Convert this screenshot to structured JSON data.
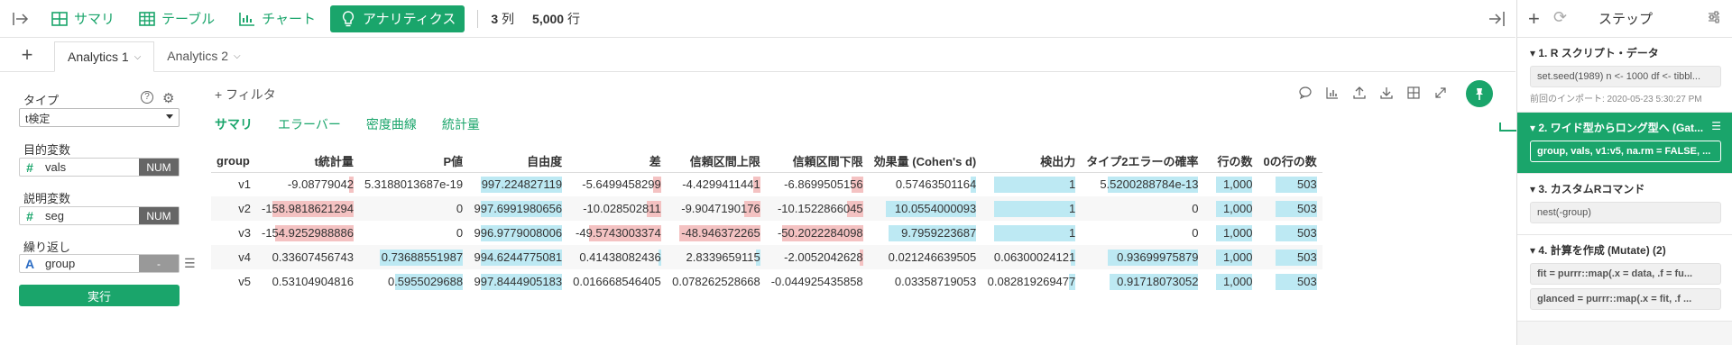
{
  "header": {
    "tabs": [
      {
        "label": "サマリ",
        "icon": "summary-icon"
      },
      {
        "label": "テーブル",
        "icon": "table-icon"
      },
      {
        "label": "チャート",
        "icon": "chart-icon"
      },
      {
        "label": "アナリティクス",
        "icon": "lightbulb-icon"
      }
    ],
    "columns_count": "3",
    "columns_unit": "列",
    "rows_count": "5,000",
    "rows_unit": "行"
  },
  "analytics_tabs": [
    "Analytics 1",
    "Analytics 2"
  ],
  "settings": {
    "type_label": "タイプ",
    "type_value": "t検定",
    "target_label": "目的変数",
    "target_value": "vals",
    "target_badge": "NUM",
    "explanatory_label": "説明変数",
    "explanatory_value": "seg",
    "explanatory_badge": "NUM",
    "repeat_label": "繰り返し",
    "repeat_value": "group",
    "repeat_badge": "-",
    "run_label": "実行"
  },
  "main": {
    "filter_label": "フィルタ",
    "subtabs": [
      "サマリ",
      "エラーバー",
      "密度曲線",
      "統計量"
    ]
  },
  "table": {
    "columns": [
      "group",
      "t統計量",
      "P値",
      "自由度",
      "差",
      "信頼区間上限",
      "信頼区間下限",
      "効果量 (Cohen's d)",
      "検出力",
      "タイプ2エラーの確率",
      "行の数",
      "0の行の数"
    ],
    "rows": [
      [
        "v1",
        "-9.08779042",
        "5.3188013687e-19",
        "997.224827119",
        "-5.6499458299",
        "-4.4299411441",
        "-6.8699505156",
        "0.57463501164",
        "1",
        "5.5200288784e-13",
        "1,000",
        "503"
      ],
      [
        "v2",
        "-158.9818621294",
        "0",
        "997.6991980656",
        "-10.028502811",
        "-9.9047190176",
        "-10.1522866045",
        "10.0554000093",
        "1",
        "0",
        "1,000",
        "503"
      ],
      [
        "v3",
        "-154.9252988886",
        "0",
        "996.9779008006",
        "-49.5743003374",
        "-48.946372265",
        "-50.2022284098",
        "9.7959223687",
        "1",
        "0",
        "1,000",
        "503"
      ],
      [
        "v4",
        "0.33607456743",
        "0.73688551987",
        "994.6244775081",
        "0.41438082436",
        "2.8339659115",
        "-2.0052042628",
        "0.021246639505",
        "0.06300024121",
        "0.93699975879",
        "1,000",
        "503"
      ],
      [
        "v5",
        "0.53104904816",
        "0.5955029688",
        "997.8444905183",
        "0.016668546405",
        "0.078262528668",
        "-0.044925435858",
        "0.03358719053",
        "0.082819269477",
        "0.91718073052",
        "1,000",
        "503"
      ]
    ],
    "bars": [
      [
        null,
        -0.06,
        0.0,
        1.0,
        -0.11,
        -0.09,
        -0.14,
        0.06,
        1.0,
        1.0,
        1.0,
        1.0
      ],
      [
        null,
        -1.0,
        0.0,
        1.0,
        -0.2,
        -0.2,
        -0.2,
        1.0,
        1.0,
        0.0,
        1.0,
        1.0
      ],
      [
        null,
        -0.97,
        0.0,
        1.0,
        -1.0,
        -1.0,
        -1.0,
        0.97,
        1.0,
        0.0,
        1.0,
        1.0
      ],
      [
        null,
        0.0,
        1.0,
        1.0,
        0.01,
        0.06,
        -0.04,
        0.0,
        0.06,
        1.0,
        1.0,
        1.0
      ],
      [
        null,
        0.0,
        0.81,
        1.0,
        0.0,
        0.0,
        0.0,
        0.0,
        0.08,
        0.98,
        1.0,
        1.0
      ]
    ]
  },
  "steps_panel": {
    "title": "ステップ",
    "steps": [
      {
        "title": "1. R スクリプト・データ",
        "code": "set.seed(1989) n <- 1000 df <- tibbl...",
        "note": "前回のインポート: 2020-05-23 5:30:27 PM"
      },
      {
        "title": "2. ワイド型からロング型へ (Gat...",
        "code": "group, vals, v1:v5, na.rm = FALSE, ..."
      },
      {
        "title": "3. カスタムRコマンド",
        "code": "nest(-group)"
      },
      {
        "title": "4. 計算を作成 (Mutate) (2)",
        "code": "fit = purrr::map(.x = data, .f = fu...",
        "code2": "glanced = purrr::map(.x = fit, .f ..."
      }
    ]
  },
  "colors": {
    "accent": "#1aa56b",
    "bar_pos": "#bde9f3",
    "bar_neg": "#f4c2c2"
  }
}
